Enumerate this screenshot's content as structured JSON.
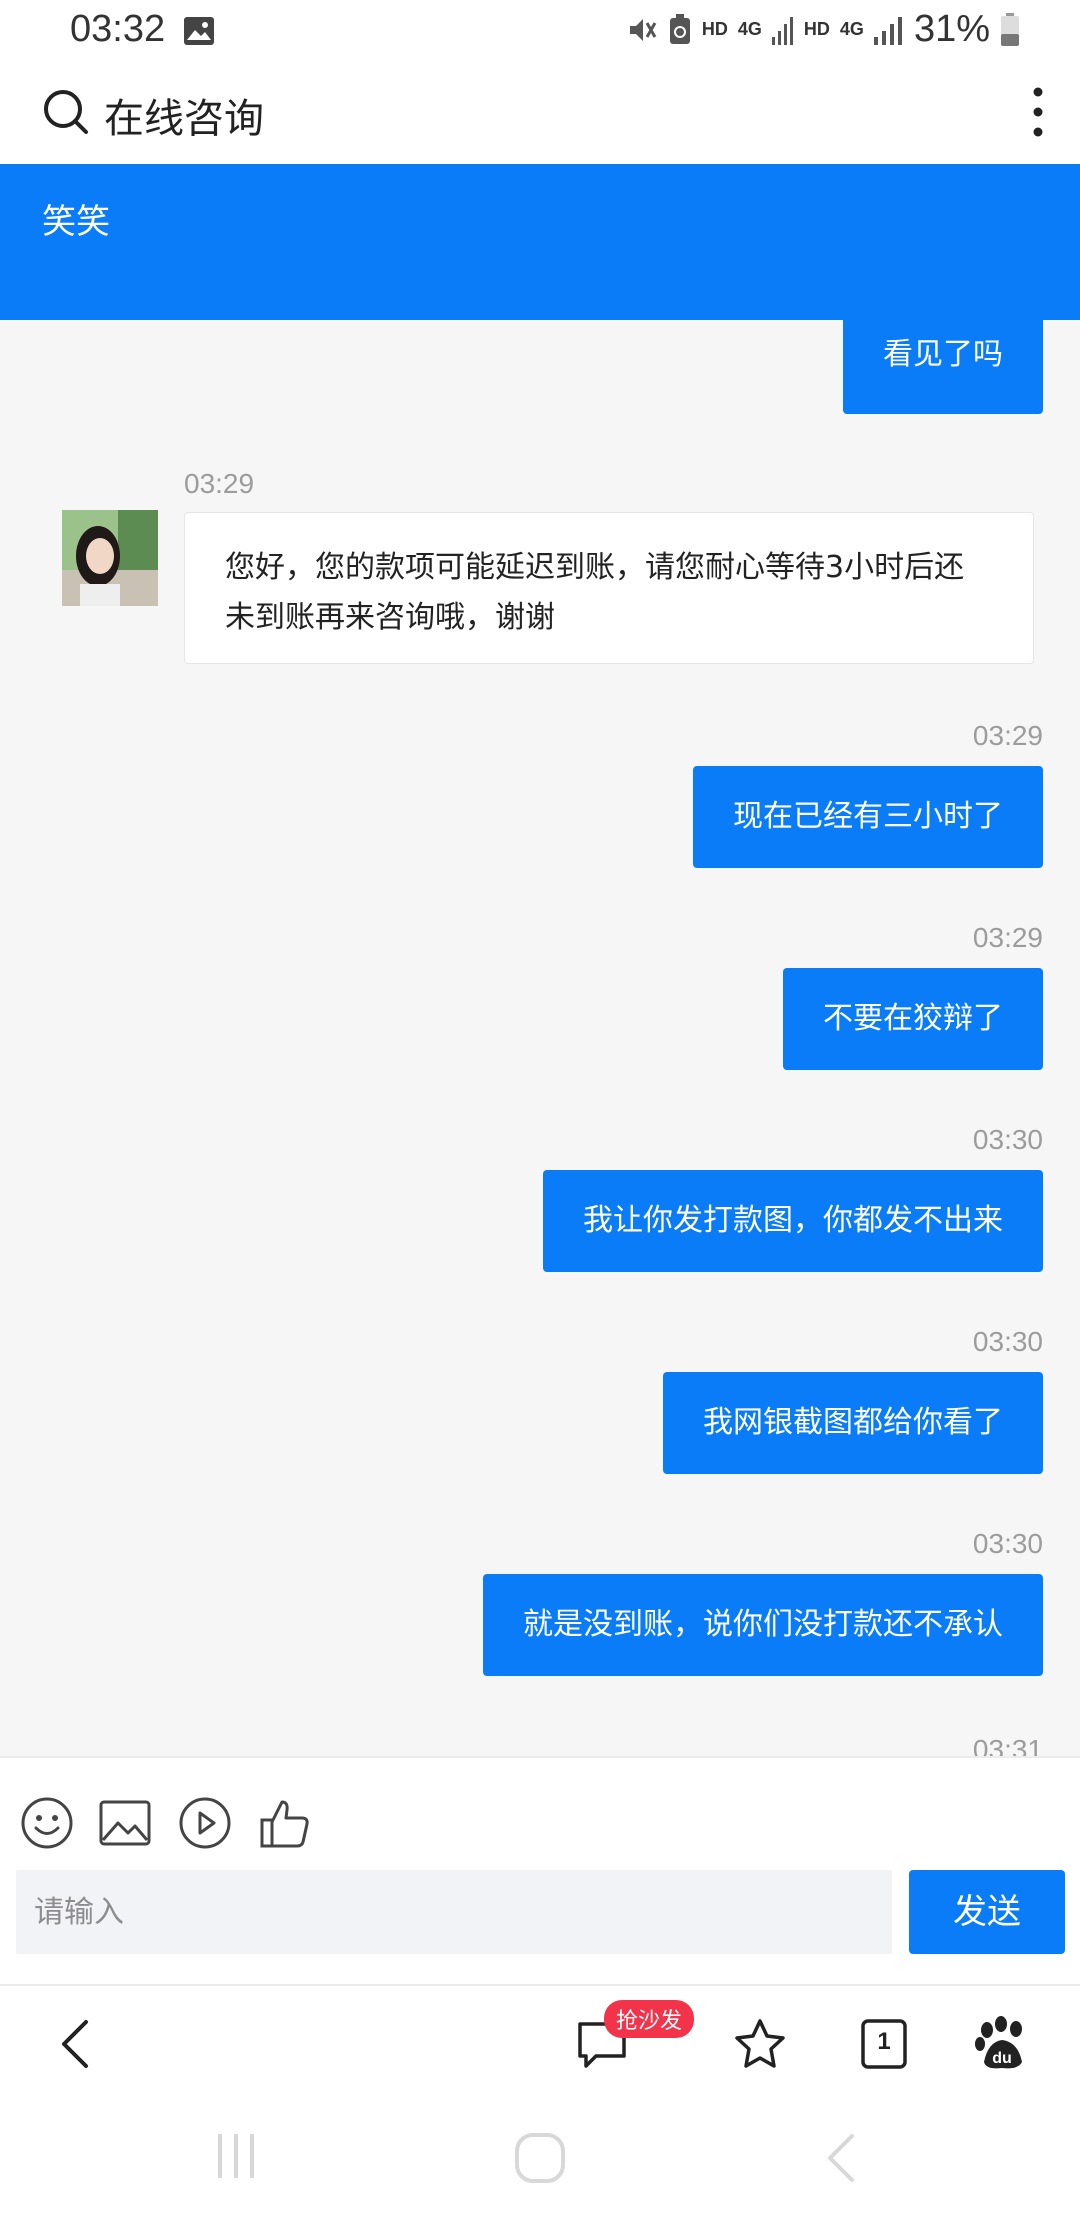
{
  "status_bar": {
    "time": "03:32",
    "hd1": "HD",
    "net1": "4G",
    "hd2": "HD",
    "net2": "4G",
    "battery": "31%"
  },
  "header": {
    "title": "在线咨询"
  },
  "banner": {
    "agent_name": "笑笑"
  },
  "messages": [
    {
      "side": "out",
      "time": "",
      "text": "看见了吗"
    },
    {
      "side": "in",
      "time": "03:29",
      "text": "您好，您的款项可能延迟到账，请您耐心等待3小时后还未到账再来咨询哦，谢谢"
    },
    {
      "side": "out",
      "time": "03:29",
      "text": "现在已经有三小时了"
    },
    {
      "side": "out",
      "time": "03:29",
      "text": "不要在狡辩了"
    },
    {
      "side": "out",
      "time": "03:30",
      "text": "我让你发打款图，你都发不出来"
    },
    {
      "side": "out",
      "time": "03:30",
      "text": "我网银截图都给你看了"
    },
    {
      "side": "out",
      "time": "03:30",
      "text": "就是没到账，说你们没打款还不承认"
    },
    {
      "side": "out",
      "time": "03:31",
      "text": ""
    }
  ],
  "composer": {
    "placeholder": "请输入",
    "send_label": "发送",
    "tools": [
      "emoji-icon",
      "image-icon",
      "video-icon",
      "like-icon"
    ]
  },
  "browser_bar": {
    "badge": "抢沙发",
    "tab_count": "1"
  },
  "colors": {
    "accent": "#0b7cf7",
    "badge": "#f2334a",
    "chat_bg": "#f6f6f7"
  }
}
